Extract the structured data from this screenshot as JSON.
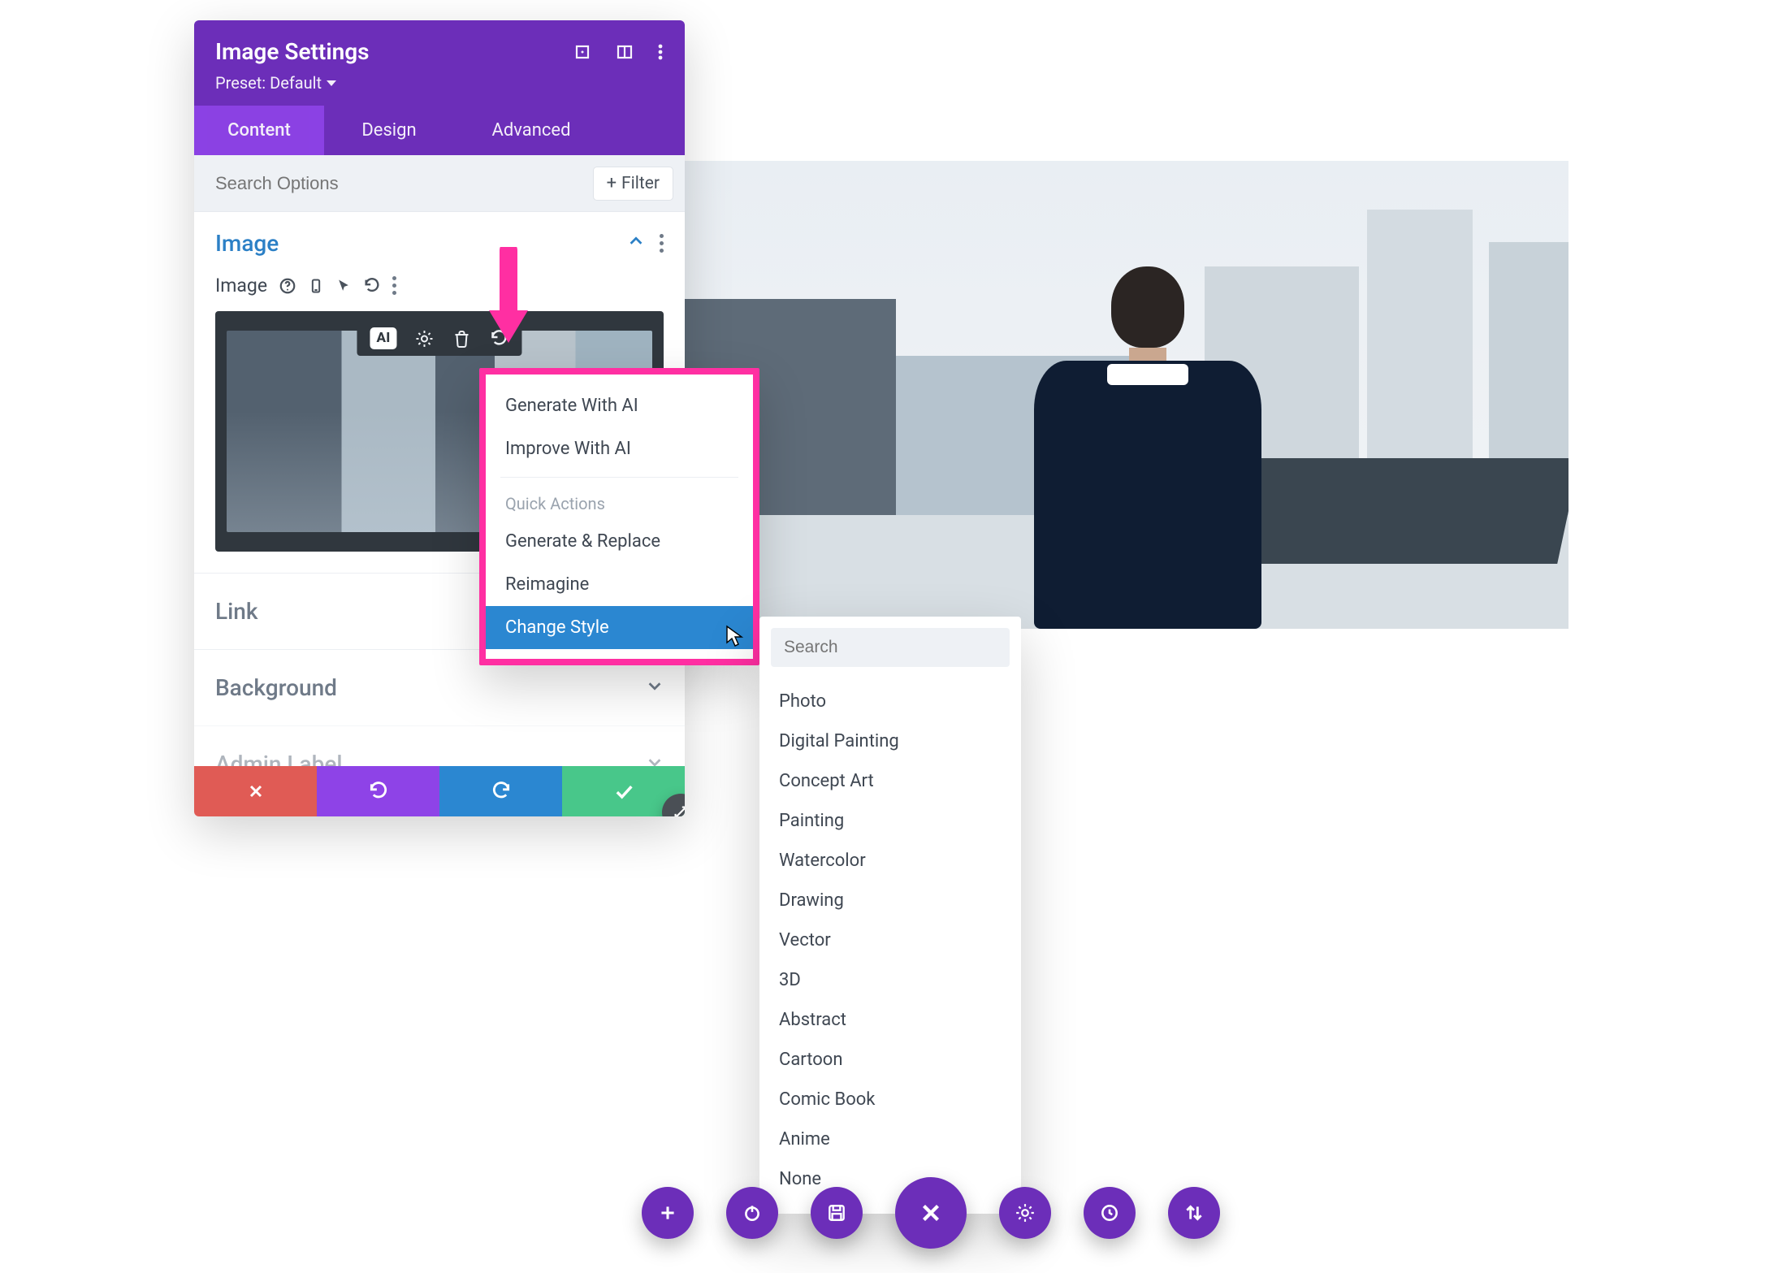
{
  "panel": {
    "title": "Image Settings",
    "preset_label": "Preset: Default",
    "tabs": {
      "content": "Content",
      "design": "Design",
      "advanced": "Advanced"
    },
    "search_placeholder": "Search Options",
    "filter_label": "Filter",
    "image_section_title": "Image",
    "image_field_label": "Image",
    "link_section_title": "Link",
    "background_section_title": "Background",
    "admin_section_title": "Admin Label"
  },
  "image_toolbar": {
    "ai_label": "AI"
  },
  "ai_menu": {
    "items_top": {
      "generate": "Generate With AI",
      "improve": "Improve With AI"
    },
    "heading": "Quick Actions",
    "items_quick": {
      "gen_replace": "Generate & Replace",
      "reimagine": "Reimagine",
      "change_style": "Change Style"
    }
  },
  "style_search_placeholder": "Search",
  "styles": {
    "photo": "Photo",
    "digital_painting": "Digital Painting",
    "concept_art": "Concept Art",
    "painting": "Painting",
    "watercolor": "Watercolor",
    "drawing": "Drawing",
    "vector": "Vector",
    "three_d": "3D",
    "abstract": "Abstract",
    "cartoon": "Cartoon",
    "comic_book": "Comic Book",
    "anime": "Anime",
    "none": "None"
  }
}
